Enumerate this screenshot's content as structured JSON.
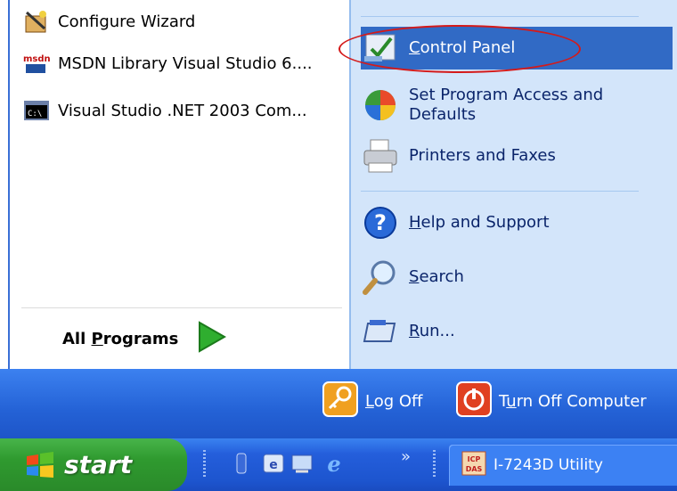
{
  "left_pane": {
    "items": [
      {
        "label": "Configure Wizard",
        "icon": "wizard-icon"
      },
      {
        "label": "MSDN Library Visual Studio 6....",
        "icon": "msdn-icon"
      },
      {
        "label": "Visual Studio .NET 2003 Com...",
        "icon": "command-prompt-icon"
      }
    ],
    "all_programs": {
      "prefix": "All ",
      "accel": "P",
      "suffix": "rograms"
    }
  },
  "right_pane": {
    "control_panel": {
      "accel": "C",
      "rest": "ontrol Panel"
    },
    "set_program_access": {
      "line1": "Set Program Access and",
      "line2": "Defaults"
    },
    "printers": {
      "label": "Printers and Faxes"
    },
    "help": {
      "accel": "H",
      "rest": "elp and Support"
    },
    "search": {
      "accel": "S",
      "rest": "earch"
    },
    "run": {
      "accel": "R",
      "rest": "un..."
    }
  },
  "bottom_bar": {
    "log_off": {
      "accel": "L",
      "rest": "og Off"
    },
    "turn_off": {
      "pre": "T",
      "accel": "u",
      "rest": "rn Off Computer"
    }
  },
  "taskbar": {
    "start_label": "start",
    "task_label": "I-7243D Utility",
    "overflow": "»"
  },
  "colors": {
    "highlight": "#316ac5",
    "annotation": "#d41a1a",
    "start_green": "#2f9a2f",
    "taskbar_blue": "#245edb"
  }
}
